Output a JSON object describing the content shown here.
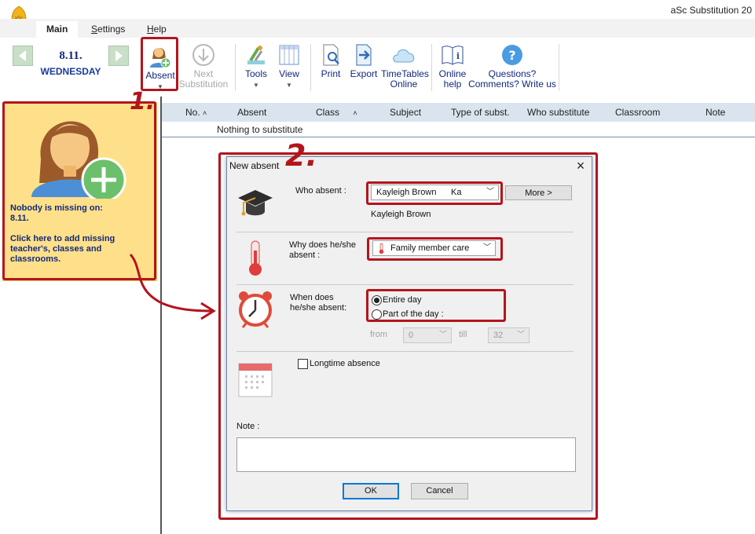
{
  "app": {
    "title": "aSc Substitution 20"
  },
  "tabs": [
    {
      "label": "Main",
      "underline": ""
    },
    {
      "label": "ettings",
      "underline": "S"
    },
    {
      "label": "elp",
      "underline": "H"
    }
  ],
  "date": {
    "day": "8.11.",
    "weekday": "WEDNESDAY"
  },
  "toolbar": {
    "absent": "Absent",
    "next_line1": "Next",
    "next_line2": "Substitution",
    "tools": "Tools",
    "view": "View",
    "print": "Print",
    "export": "Export",
    "timetables_line1": "TimeTables",
    "timetables_line2": "Online",
    "online_help_line1": "Online",
    "online_help_line2": "help",
    "questions_line1": "Questions?",
    "questions_line2": "Comments? Write us"
  },
  "missing_panel": {
    "line1": "Nobody is missing on:",
    "line2": "8.11.",
    "line3": "Click here to add missing",
    "line4": "teacher's, classes and",
    "line5": "classrooms."
  },
  "table": {
    "columns": [
      "No.",
      "Absent",
      "Class",
      "Subject",
      "Type of subst.",
      "Who substitute",
      "Classroom",
      "Note"
    ],
    "empty_message": "Nothing to substitute"
  },
  "dialog": {
    "title": "New absent",
    "who_label": "Who absent :",
    "who_value_name": "Kayleigh Brown",
    "who_value_code": "Ka",
    "who_subtext": "Kayleigh Brown",
    "more_button": "More >",
    "why_label_line1": "Why does he/she",
    "why_label_line2": "absent :",
    "why_value": "Family member care",
    "when_label_line1": "When does",
    "when_label_line2": "he/she absent:",
    "entire_day": "Entire day",
    "part_of_day": "Part of the day :",
    "from_label": "from",
    "from_value": "0",
    "till_label": "till",
    "till_value": "32",
    "longtime_label": "Longtime absence",
    "note_label": "Note :",
    "note_value": "",
    "ok": "OK",
    "cancel": "Cancel"
  },
  "annotations": {
    "step1": "1.",
    "step2": "2."
  },
  "colors": {
    "annotation": "#b3151d",
    "panel": "#ffe08a",
    "header": "#dae4ef",
    "nav": "#c8dfc8"
  }
}
